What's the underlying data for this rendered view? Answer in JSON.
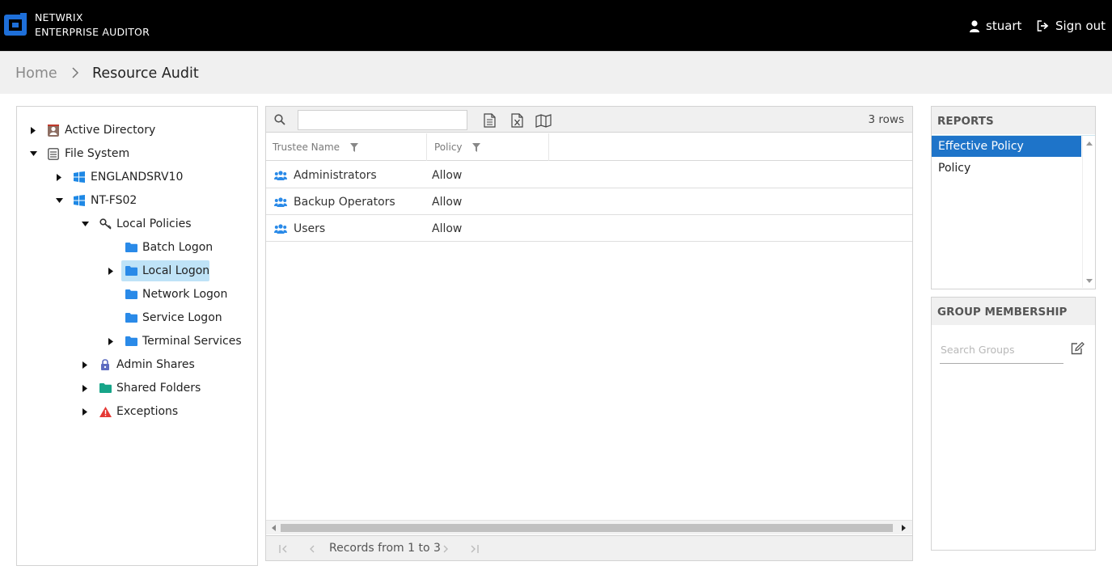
{
  "header": {
    "brand_line1": "NETWRIX",
    "brand_line2": "ENTERPRISE AUDITOR",
    "user_name": "stuart",
    "signout_label": "Sign out"
  },
  "breadcrumb": {
    "home": "Home",
    "current": "Resource Audit"
  },
  "tree": [
    {
      "label": "Active Directory",
      "icon": "active-directory-icon",
      "expanded": false
    },
    {
      "label": "File System",
      "icon": "file-system-icon",
      "expanded": true
    },
    {
      "label": "ENGLANDSRV10",
      "icon": "windows-icon",
      "expanded": false
    },
    {
      "label": "NT-FS02",
      "icon": "windows-icon",
      "expanded": true
    },
    {
      "label": "Local Policies",
      "icon": "key-icon",
      "expanded": true
    },
    {
      "label": "Batch Logon",
      "icon": "folder-icon"
    },
    {
      "label": "Local Logon",
      "icon": "folder-icon",
      "expanded": false,
      "selected": true
    },
    {
      "label": "Network Logon",
      "icon": "folder-icon"
    },
    {
      "label": "Service Logon",
      "icon": "folder-icon"
    },
    {
      "label": "Terminal Services",
      "icon": "folder-icon",
      "expanded": false
    },
    {
      "label": "Admin Shares",
      "icon": "lock-icon",
      "expanded": false
    },
    {
      "label": "Shared Folders",
      "icon": "folder-icon",
      "expanded": false
    },
    {
      "label": "Exceptions",
      "icon": "warning-icon",
      "expanded": false
    }
  ],
  "grid": {
    "search_value": "",
    "rows_count": "3 rows",
    "columns": [
      "Trustee Name",
      "Policy"
    ],
    "rows": [
      {
        "trustee": "Administrators",
        "policy": "Allow"
      },
      {
        "trustee": "Backup Operators",
        "policy": "Allow"
      },
      {
        "trustee": "Users",
        "policy": "Allow"
      }
    ],
    "pager_text": "Records from 1 to 3"
  },
  "reports": {
    "title": "REPORTS",
    "items": [
      "Effective Policy",
      "Policy"
    ],
    "selected": "Effective Policy"
  },
  "group_membership": {
    "title": "GROUP MEMBERSHIP",
    "search_placeholder": "Search Groups",
    "search_value": ""
  },
  "colors": {
    "topbar": "#000000",
    "brand_blue": "#1e6fd9",
    "selection": "#bfe3f7",
    "report_active": "#1e74c9",
    "folder": "#2a8ae8",
    "shared_folder": "#17a589",
    "warning": "#e53935",
    "admin_shares": "#5c6bc0"
  }
}
